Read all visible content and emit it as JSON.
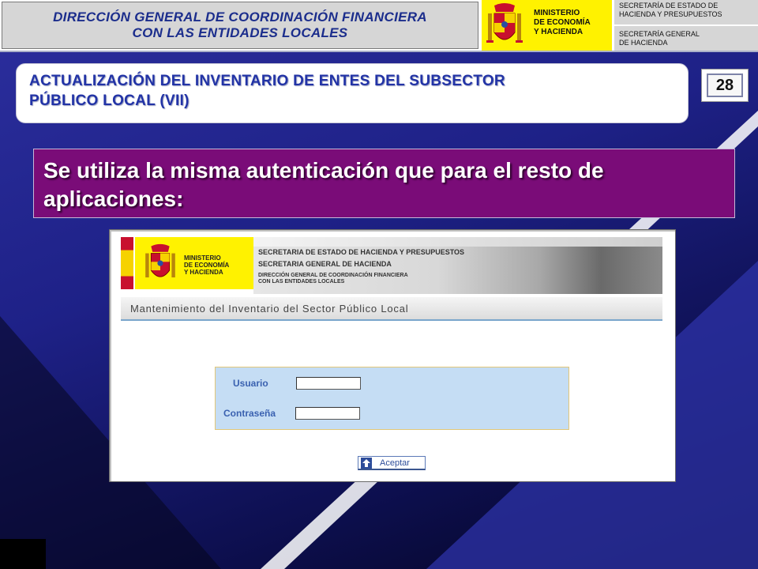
{
  "header": {
    "directorate_line1": "DIRECCIÓN GENERAL DE COORDINACIÓN FINANCIERA",
    "directorate_line2": "CON LAS ENTIDADES LOCALES",
    "ministry_line1": "MINISTERIO",
    "ministry_line2": "DE ECONOMÍA",
    "ministry_line3": "Y HACIENDA",
    "secretary1_line1": "SECRETARÍA DE ESTADO DE",
    "secretary1_line2": "HACIENDA Y PRESUPUESTOS",
    "secretary2_line1": "SECRETARÍA GENERAL",
    "secretary2_line2": "DE HACIENDA",
    "coat_of_arms_icon": "spain-coat-of-arms-icon",
    "colors": {
      "yellow": "#fff200",
      "grey": "#d6d6d6",
      "navy_text": "#1b2d8c"
    }
  },
  "slide": {
    "title_line1": "ACTUALIZACIÓN DEL INVENTARIO DE ENTES DEL SUBSECTOR",
    "title_line2": "PÚBLICO LOCAL (VII)",
    "page_number": "28",
    "banner_line1": "Se utiliza la misma autenticación que para el resto de",
    "banner_line2": "aplicaciones:",
    "colors": {
      "banner": "#7a0c78",
      "title": "#2233a6"
    }
  },
  "app_screenshot": {
    "ministry_line1": "MINISTERIO",
    "ministry_line2": "DE ECONOMÍA",
    "ministry_line3": "Y HACIENDA",
    "header_line1": "SECRETARIA DE ESTADO DE HACIENDA Y PRESUPUESTOS",
    "header_line2": "SECRETARIA GENERAL DE HACIENDA",
    "header_line3a": "DIRECCIÓN GENERAL DE COORDINACIÓN FINANCIERA",
    "header_line3b": "CON LAS ENTIDADES LOCALES",
    "app_title": "Mantenimiento del Inventario del Sector Público Local",
    "username_label": "Usuario",
    "username_value": "",
    "password_label": "Contraseña",
    "password_value": "",
    "submit_label": "Aceptar",
    "submit_icon": "arrow-up-icon",
    "colors": {
      "login_panel": "#c5ddf4",
      "label": "#3a61b0"
    }
  }
}
